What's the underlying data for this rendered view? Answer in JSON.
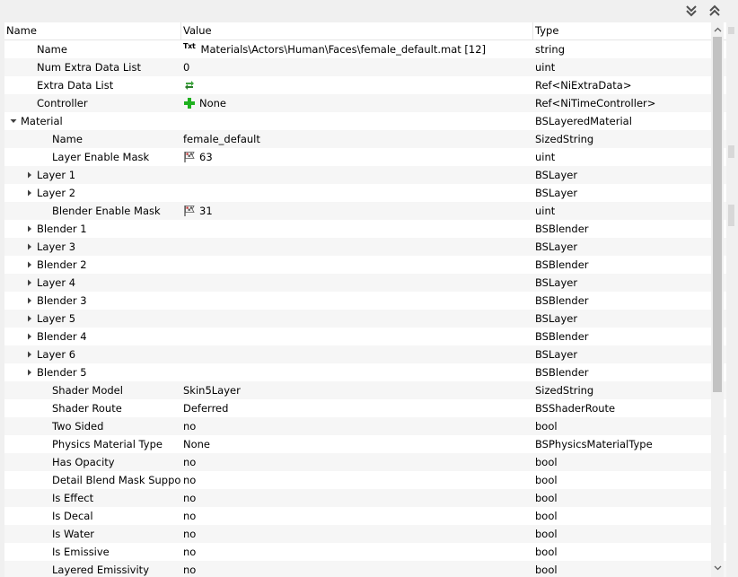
{
  "window": {
    "collapse_all_icon": "double-chevron-down-icon",
    "expand_all_icon": "double-chevron-up-icon"
  },
  "columns": {
    "name": "Name",
    "value": "Value",
    "type": "Type"
  },
  "rows": [
    {
      "name": "Name",
      "value": "Materials\\Actors\\Human\\Faces\\female_default.mat [12]",
      "type": "string",
      "depth": 1,
      "expand": "none",
      "icon": "txt"
    },
    {
      "name": "Num Extra Data List",
      "value": "0",
      "type": "uint",
      "depth": 1,
      "expand": "none",
      "icon": ""
    },
    {
      "name": "Extra Data List",
      "value": "",
      "type": "Ref<NiExtraData>",
      "depth": 1,
      "expand": "none",
      "icon": "link"
    },
    {
      "name": "Controller",
      "value": "None",
      "type": "Ref<NiTimeController>",
      "depth": 1,
      "expand": "none",
      "icon": "plus"
    },
    {
      "name": "Material",
      "value": "",
      "type": "BSLayeredMaterial",
      "depth": 0,
      "expand": "open",
      "icon": ""
    },
    {
      "name": "Name",
      "value": "female_default",
      "type": "SizedString",
      "depth": 2,
      "expand": "none",
      "icon": ""
    },
    {
      "name": "Layer Enable Mask",
      "value": "63",
      "type": "uint",
      "depth": 2,
      "expand": "none",
      "icon": "flag"
    },
    {
      "name": "Layer 1",
      "value": "",
      "type": "BSLayer",
      "depth": 1,
      "expand": "closed",
      "icon": ""
    },
    {
      "name": "Layer 2",
      "value": "",
      "type": "BSLayer",
      "depth": 1,
      "expand": "closed",
      "icon": ""
    },
    {
      "name": "Blender Enable Mask",
      "value": "31",
      "type": "uint",
      "depth": 2,
      "expand": "none",
      "icon": "flag"
    },
    {
      "name": "Blender 1",
      "value": "",
      "type": "BSBlender",
      "depth": 1,
      "expand": "closed",
      "icon": ""
    },
    {
      "name": "Layer 3",
      "value": "",
      "type": "BSLayer",
      "depth": 1,
      "expand": "closed",
      "icon": ""
    },
    {
      "name": "Blender 2",
      "value": "",
      "type": "BSBlender",
      "depth": 1,
      "expand": "closed",
      "icon": ""
    },
    {
      "name": "Layer 4",
      "value": "",
      "type": "BSLayer",
      "depth": 1,
      "expand": "closed",
      "icon": ""
    },
    {
      "name": "Blender 3",
      "value": "",
      "type": "BSBlender",
      "depth": 1,
      "expand": "closed",
      "icon": ""
    },
    {
      "name": "Layer 5",
      "value": "",
      "type": "BSLayer",
      "depth": 1,
      "expand": "closed",
      "icon": ""
    },
    {
      "name": "Blender 4",
      "value": "",
      "type": "BSBlender",
      "depth": 1,
      "expand": "closed",
      "icon": ""
    },
    {
      "name": "Layer 6",
      "value": "",
      "type": "BSLayer",
      "depth": 1,
      "expand": "closed",
      "icon": ""
    },
    {
      "name": "Blender 5",
      "value": "",
      "type": "BSBlender",
      "depth": 1,
      "expand": "closed",
      "icon": ""
    },
    {
      "name": "Shader Model",
      "value": "Skin5Layer",
      "type": "SizedString",
      "depth": 2,
      "expand": "none",
      "icon": ""
    },
    {
      "name": "Shader Route",
      "value": "Deferred",
      "type": "BSShaderRoute",
      "depth": 2,
      "expand": "none",
      "icon": ""
    },
    {
      "name": "Two Sided",
      "value": "no",
      "type": "bool",
      "depth": 2,
      "expand": "none",
      "icon": ""
    },
    {
      "name": "Physics Material Type",
      "value": "None",
      "type": "BSPhysicsMaterialType",
      "depth": 2,
      "expand": "none",
      "icon": ""
    },
    {
      "name": "Has Opacity",
      "value": "no",
      "type": "bool",
      "depth": 2,
      "expand": "none",
      "icon": ""
    },
    {
      "name": "Detail Blend Mask Support...",
      "value": "no",
      "type": "bool",
      "depth": 2,
      "expand": "none",
      "icon": ""
    },
    {
      "name": "Is Effect",
      "value": "no",
      "type": "bool",
      "depth": 2,
      "expand": "none",
      "icon": ""
    },
    {
      "name": "Is Decal",
      "value": "no",
      "type": "bool",
      "depth": 2,
      "expand": "none",
      "icon": ""
    },
    {
      "name": "Is Water",
      "value": "no",
      "type": "bool",
      "depth": 2,
      "expand": "none",
      "icon": ""
    },
    {
      "name": "Is Emissive",
      "value": "no",
      "type": "bool",
      "depth": 2,
      "expand": "none",
      "icon": ""
    },
    {
      "name": "Layered Emissivity",
      "value": "no",
      "type": "bool",
      "depth": 2,
      "expand": "none",
      "icon": ""
    }
  ],
  "colors": {
    "alt_row": "#f6f6f6",
    "header_border": "#e5e5e5",
    "plus_green": "#1fb11f",
    "scroll_thumb": "#c2c2c2"
  }
}
